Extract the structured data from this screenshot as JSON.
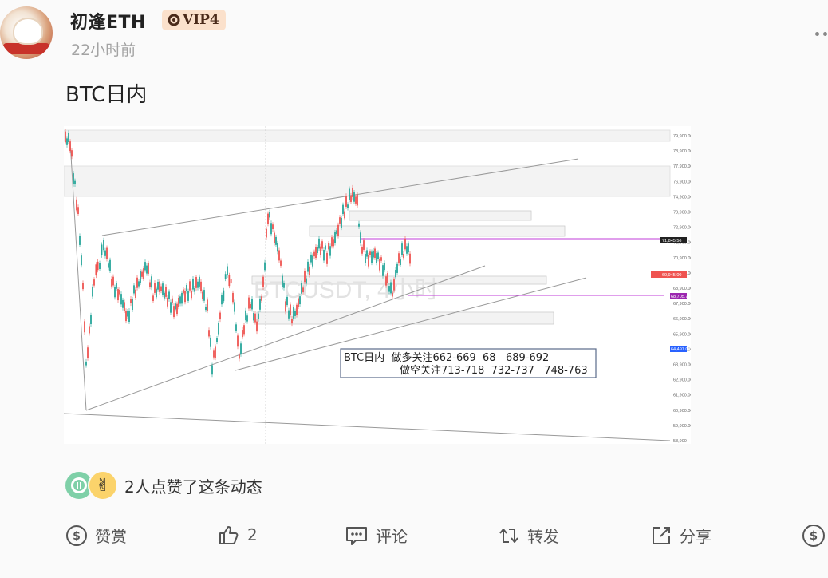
{
  "post": {
    "username": "初逢ETH",
    "vip_label": "VIP4",
    "time": "22小时前",
    "text": "BTC日内"
  },
  "chart": {
    "watermark": "BTCUSDT, 4小时",
    "price_ticks": [
      "79,900.00",
      "78,900.00",
      "77,900.00",
      "76,900.00",
      "74,900.00",
      "73,900.00",
      "72,900.00",
      "71,900.00",
      "70,900.00",
      "69,900.00",
      "68,900.00",
      "67,900.00",
      "66,900.00",
      "65,900.00",
      "64,900.00",
      "63,900.00",
      "62,900.00",
      "61,900.00",
      "60,900.00",
      "59,900.00",
      "58,900"
    ],
    "label_upper": "71,845.56",
    "label_current": "69,945.00",
    "label_lower": "68,705.70",
    "label_blue": "64,497.00",
    "annotation_line1": "BTC日内  做多关注662-669  68   689-692",
    "annotation_line2": "做空关注713-718  732-737   748-763"
  },
  "likes": {
    "text": "2人点赞了这条动态",
    "avatar2_emoji": "✌"
  },
  "actions": {
    "reward": "赞赏",
    "like_count": "2",
    "comment": "评论",
    "repost": "转发",
    "share": "分享"
  },
  "colors": {
    "accent_magenta": "#c03cd8",
    "candle_up": "#26a69a",
    "candle_down": "#ef5350",
    "vip_bg": "#fbe1cc",
    "like_avatar_1": "#7fd0a8",
    "like_avatar_2": "#fbd36b"
  },
  "icons": [
    "more-icon",
    "vip-icon",
    "reward-icon",
    "like-icon",
    "comment-icon",
    "repost-icon",
    "share-icon",
    "tip-icon"
  ]
}
